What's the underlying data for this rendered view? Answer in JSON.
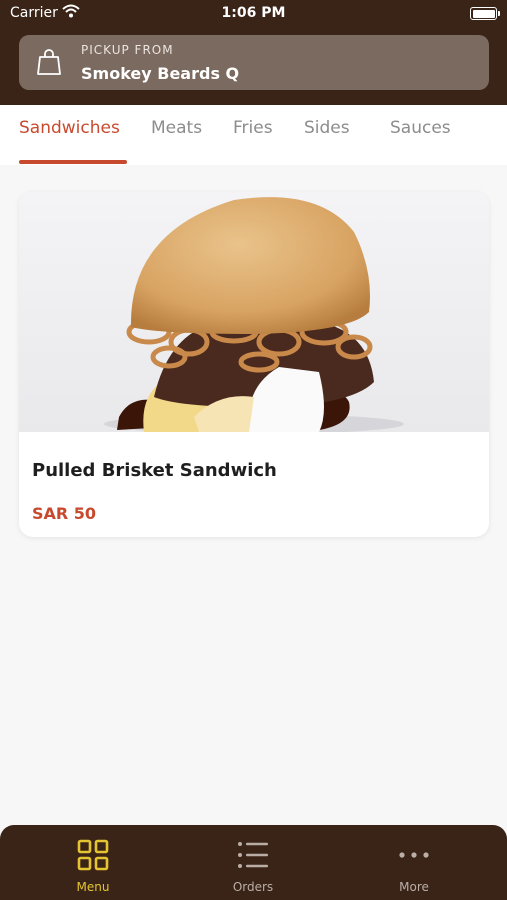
{
  "status_bar": {
    "carrier": "Carrier",
    "time": "1:06 PM"
  },
  "pickup": {
    "label": "PICKUP FROM",
    "store": "Smokey Beards Q"
  },
  "tabs": [
    {
      "label": "Sandwiches",
      "active": true
    },
    {
      "label": "Meats",
      "active": false
    },
    {
      "label": "Fries",
      "active": false
    },
    {
      "label": "Sides",
      "active": false
    },
    {
      "label": "Sauces",
      "active": false
    }
  ],
  "products": [
    {
      "name": "Pulled Brisket Sandwich",
      "price": "SAR 50"
    }
  ],
  "bottom_nav": [
    {
      "label": "Menu",
      "icon": "grid-icon",
      "active": true
    },
    {
      "label": "Orders",
      "icon": "list-icon",
      "active": false
    },
    {
      "label": "More",
      "icon": "more-icon",
      "active": false
    }
  ],
  "colors": {
    "header_brown": "#3a2417",
    "accent_red": "#c84a2e",
    "active_nav_yellow": "#e4c531"
  }
}
